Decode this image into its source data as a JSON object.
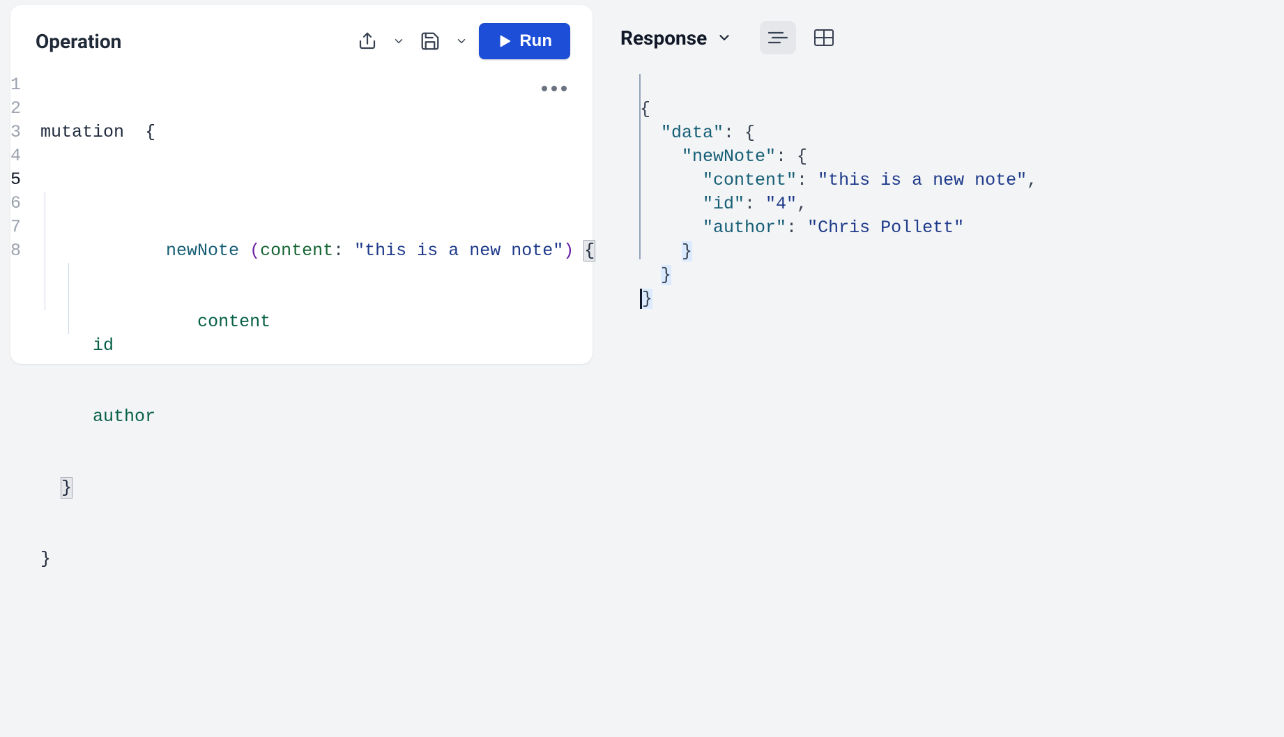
{
  "operation": {
    "title": "Operation",
    "run_label": "Run",
    "lines": [
      "1",
      "2",
      "3",
      "4",
      "5",
      "6",
      "7",
      "8"
    ],
    "current_line_idx": 4,
    "code": {
      "keyword": "mutation",
      "call": "newNote",
      "arg": "content",
      "argval": "\"this is a new note\"",
      "fields": [
        "content",
        "id",
        "author"
      ]
    }
  },
  "response": {
    "title": "Response",
    "json": {
      "data_key": "\"data\"",
      "newnote_key": "\"newNote\"",
      "content_key": "\"content\"",
      "content_val": "\"this is a new note\"",
      "id_key": "\"id\"",
      "id_val": "\"4\"",
      "author_key": "\"author\"",
      "author_val": "\"Chris Pollett\""
    }
  }
}
